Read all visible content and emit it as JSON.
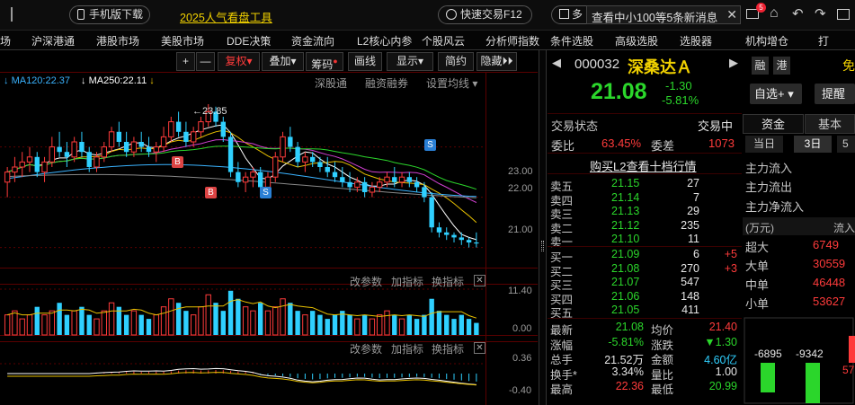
{
  "topbar": {
    "mobile_label": "手机版下载",
    "promo_link": "2025人气看盘工具",
    "quick_trade": "快速交易F12",
    "multi_label": "多",
    "news_banner": "查看中小100等5条新消息",
    "badge_count": "5"
  },
  "menu": [
    "场",
    "沪深港通",
    "港股市场",
    "美股市场",
    "DDE决策",
    "资金流向",
    "L2核心内参",
    "个股风云",
    "分析师指数",
    "条件选股",
    "高级选股",
    "选股器",
    "机构增仓",
    "打"
  ],
  "toolbar": {
    "plus": "+",
    "minus": "—",
    "fuquan": "复权",
    "diejia": "叠加",
    "chouma": "筹码",
    "huaxian": "画线",
    "xianshi": "显示",
    "jianyue": "简约",
    "yincang": "隐藏"
  },
  "chart_header": {
    "ma120": "MA120:22.37",
    "ma250": "MA250:22.11",
    "links": [
      "深股通",
      "融资融券",
      "设置均线"
    ],
    "high_annot": "23.85",
    "markers": [
      "B",
      "B",
      "S",
      "S"
    ]
  },
  "price_axis": [
    "23.00",
    "22.00",
    "21.00"
  ],
  "volume_panel": {
    "buttons": [
      "改参数",
      "加指标",
      "换指标"
    ],
    "axis": [
      "11.40",
      "0.00"
    ]
  },
  "macd_panel": {
    "buttons": [
      "改参数",
      "加指标",
      "换指标"
    ],
    "axis": [
      "0.36",
      "-0.40"
    ]
  },
  "chart_data": {
    "type": "candlestick",
    "candles": [
      [
        22.3,
        22.6,
        22.0,
        22.5
      ],
      [
        22.5,
        22.8,
        22.3,
        22.6
      ],
      [
        22.6,
        22.9,
        22.4,
        22.7
      ],
      [
        22.7,
        23.0,
        22.5,
        22.8
      ],
      [
        22.8,
        22.9,
        22.4,
        22.5
      ],
      [
        22.5,
        22.8,
        22.3,
        22.7
      ],
      [
        22.7,
        23.2,
        22.6,
        23.0
      ],
      [
        23.0,
        23.3,
        22.8,
        22.9
      ],
      [
        22.9,
        23.1,
        22.6,
        22.8
      ],
      [
        22.8,
        23.2,
        22.7,
        23.1
      ],
      [
        23.1,
        23.3,
        22.8,
        22.9
      ],
      [
        22.9,
        23.0,
        22.5,
        22.6
      ],
      [
        22.6,
        22.9,
        22.5,
        22.8
      ],
      [
        22.8,
        23.1,
        22.7,
        23.0
      ],
      [
        23.0,
        23.4,
        22.9,
        23.3
      ],
      [
        23.3,
        23.5,
        23.0,
        23.1
      ],
      [
        23.1,
        23.3,
        22.8,
        22.9
      ],
      [
        22.9,
        23.2,
        22.8,
        23.1
      ],
      [
        23.1,
        23.3,
        22.9,
        23.0
      ],
      [
        23.0,
        23.2,
        22.8,
        22.9
      ],
      [
        22.9,
        23.1,
        22.7,
        23.0
      ],
      [
        23.0,
        23.4,
        22.9,
        23.2
      ],
      [
        23.2,
        23.6,
        23.1,
        23.5
      ],
      [
        23.5,
        23.7,
        23.2,
        23.3
      ],
      [
        23.3,
        23.5,
        23.0,
        23.1
      ],
      [
        23.1,
        23.4,
        23.0,
        23.3
      ],
      [
        23.3,
        23.6,
        23.2,
        23.5
      ],
      [
        23.5,
        23.85,
        23.4,
        23.7
      ],
      [
        23.7,
        23.8,
        23.4,
        23.5
      ],
      [
        23.5,
        23.6,
        23.1,
        23.2
      ],
      [
        23.2,
        23.3,
        22.4,
        22.5
      ],
      [
        22.5,
        22.7,
        22.2,
        22.3
      ],
      [
        22.3,
        22.5,
        22.1,
        22.4
      ],
      [
        22.4,
        22.6,
        22.2,
        22.5
      ],
      [
        22.5,
        22.6,
        22.1,
        22.2
      ],
      [
        22.2,
        22.5,
        22.1,
        22.4
      ],
      [
        22.4,
        22.9,
        22.3,
        22.8
      ],
      [
        22.8,
        23.3,
        22.7,
        23.2
      ],
      [
        23.2,
        23.4,
        22.9,
        23.0
      ],
      [
        23.0,
        23.1,
        22.6,
        22.7
      ],
      [
        22.7,
        22.9,
        22.5,
        22.8
      ],
      [
        22.8,
        22.9,
        22.6,
        22.7
      ],
      [
        22.7,
        22.8,
        22.5,
        22.6
      ],
      [
        22.6,
        22.8,
        22.4,
        22.5
      ],
      [
        22.5,
        22.7,
        22.3,
        22.4
      ],
      [
        22.4,
        22.6,
        22.2,
        22.3
      ],
      [
        22.3,
        22.5,
        22.1,
        22.2
      ],
      [
        22.2,
        22.4,
        22.1,
        22.3
      ],
      [
        22.3,
        22.4,
        22.0,
        22.1
      ],
      [
        22.1,
        22.3,
        22.0,
        22.2
      ],
      [
        22.2,
        22.4,
        22.1,
        22.3
      ],
      [
        22.3,
        22.5,
        22.2,
        22.4
      ],
      [
        22.4,
        22.6,
        22.2,
        22.3
      ],
      [
        22.3,
        22.5,
        22.2,
        22.4
      ],
      [
        22.4,
        22.5,
        22.2,
        22.3
      ],
      [
        22.3,
        22.4,
        22.1,
        22.2
      ],
      [
        22.2,
        22.3,
        21.9,
        22.0
      ],
      [
        22.0,
        22.1,
        21.3,
        21.4
      ],
      [
        21.4,
        21.5,
        21.2,
        21.3
      ],
      [
        21.3,
        21.4,
        21.15,
        21.25
      ],
      [
        21.25,
        21.3,
        21.1,
        21.2
      ],
      [
        21.2,
        21.3,
        21.05,
        21.15
      ],
      [
        21.15,
        21.2,
        21.0,
        21.1
      ],
      [
        21.1,
        21.3,
        21.0,
        21.08
      ]
    ],
    "volumes": [
      5,
      6,
      4,
      5,
      7,
      5,
      6,
      8,
      5,
      6,
      7,
      5,
      4,
      6,
      8,
      7,
      5,
      6,
      5,
      4,
      5,
      7,
      9,
      8,
      6,
      5,
      7,
      10,
      8,
      6,
      11,
      9,
      7,
      6,
      8,
      6,
      7,
      9,
      8,
      6,
      5,
      6,
      5,
      4,
      5,
      6,
      5,
      4,
      5,
      4,
      5,
      6,
      5,
      4,
      5,
      4,
      5,
      9,
      6,
      5,
      4,
      5,
      4,
      3
    ],
    "ylim": [
      20.6,
      24.1
    ]
  },
  "stock": {
    "code": "000032",
    "name": "深桑达Ａ",
    "tag_rong": "融",
    "tag_gang": "港",
    "extra": "免",
    "price": "21.08",
    "change": "-1.30",
    "change_pct": "-5.81%",
    "zixuan": "自选+",
    "tixing": "提醒"
  },
  "status": {
    "label": "交易状态",
    "value": "交易中",
    "weibi_label": "委比",
    "weibi": "63.45%",
    "weicha_label": "委差",
    "weicha": "1073"
  },
  "l2_link": "购买L2查看十档行情",
  "asks": [
    {
      "label": "卖五",
      "price": "21.15",
      "vol": "27"
    },
    {
      "label": "卖四",
      "price": "21.14",
      "vol": "7"
    },
    {
      "label": "卖三",
      "price": "21.13",
      "vol": "29"
    },
    {
      "label": "卖二",
      "price": "21.12",
      "vol": "235"
    },
    {
      "label": "卖一",
      "price": "21.10",
      "vol": "11"
    }
  ],
  "bids": [
    {
      "label": "买一",
      "price": "21.09",
      "vol": "6",
      "delta": "+5"
    },
    {
      "label": "买二",
      "price": "21.08",
      "vol": "270",
      "delta": "+3"
    },
    {
      "label": "买三",
      "price": "21.07",
      "vol": "547",
      "delta": ""
    },
    {
      "label": "买四",
      "price": "21.06",
      "vol": "148",
      "delta": ""
    },
    {
      "label": "买五",
      "price": "21.05",
      "vol": "411",
      "delta": ""
    }
  ],
  "stats": [
    {
      "l1": "最新",
      "v1": "21.08",
      "l2": "均价",
      "v2": "21.40"
    },
    {
      "l1": "涨幅",
      "v1": "-5.81%",
      "l2": "涨跌",
      "v2": "▼1.30"
    },
    {
      "l1": "总手",
      "v1": "21.52万",
      "l2": "金额",
      "v2": "4.60亿"
    },
    {
      "l1": "换手*",
      "v1": "3.34%",
      "l2": "量比",
      "v2": "1.00"
    },
    {
      "l1": "最高",
      "v1": "22.36",
      "l2": "最低",
      "v2": "20.99"
    }
  ],
  "fund": {
    "tab_zijin": "资金",
    "tab_jiben": "基本",
    "sub_tabs": [
      "当日",
      "3日",
      "5"
    ],
    "flows": [
      "主力流入",
      "主力流出",
      "主力净流入"
    ],
    "unit": "(万元)",
    "inflow_header": "流入",
    "rows": [
      {
        "label": "超大",
        "value": "6749"
      },
      {
        "label": "大单",
        "value": "30559"
      },
      {
        "label": "中单",
        "value": "46448"
      },
      {
        "label": "小单",
        "value": "53627"
      }
    ],
    "bars": [
      "-6895",
      "-9342",
      "57"
    ]
  }
}
